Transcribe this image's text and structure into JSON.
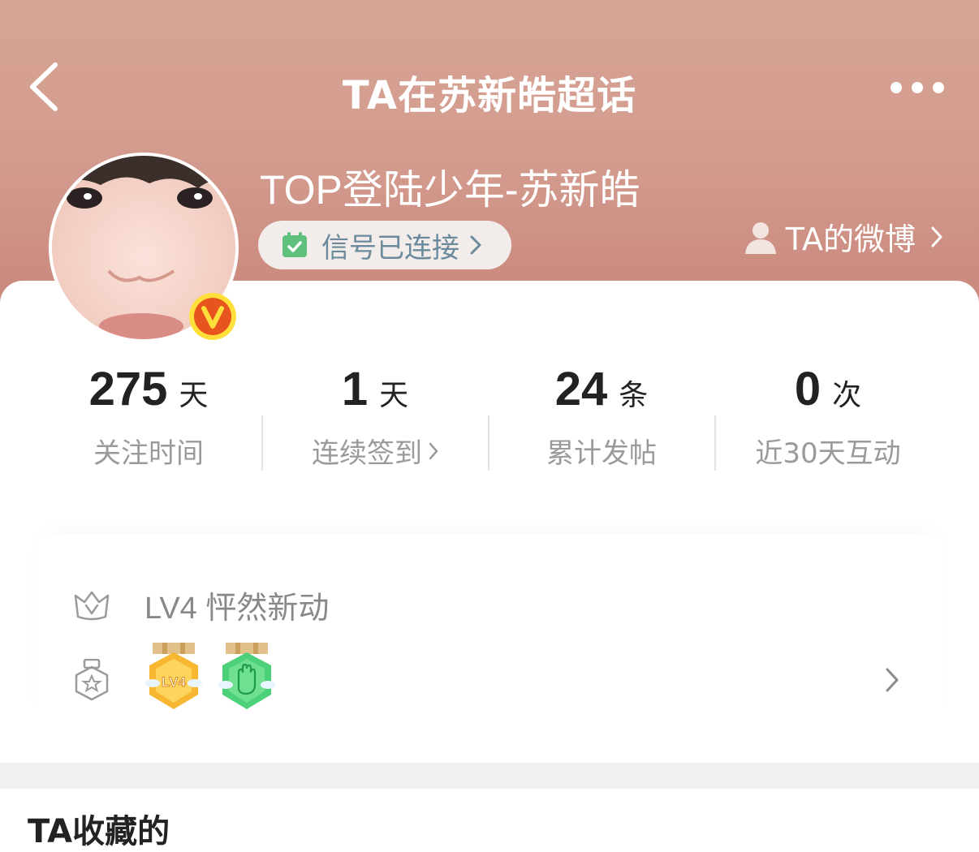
{
  "nav": {
    "title": "TA在苏新皓超话",
    "back_icon": "chevron-left-icon",
    "more_icon": "more-dots-icon"
  },
  "profile": {
    "name": "TOP登陆少年-苏新皓",
    "signal_label": "信号已连接",
    "weibo_link": "TA的微博",
    "verified_badge": "V"
  },
  "stats": [
    {
      "value": "275",
      "unit": "天",
      "label": "关注时间",
      "has_arrow": false
    },
    {
      "value": "1",
      "unit": "天",
      "label": "连续签到",
      "has_arrow": true
    },
    {
      "value": "24",
      "unit": "条",
      "label": "累计发帖",
      "has_arrow": false
    },
    {
      "value": "0",
      "unit": "次",
      "label": "近30天互动",
      "has_arrow": false
    }
  ],
  "level": {
    "text": "LV4 怦然新动"
  },
  "medals": [
    {
      "name": "lv4-medal",
      "text": "LV4",
      "color": "#f7b731"
    },
    {
      "name": "hand-medal",
      "color": "#4cd07a"
    }
  ],
  "section": {
    "title": "TA收藏的"
  },
  "colors": {
    "header_top": "#d7a596",
    "header_bottom": "#c88378",
    "accent_red": "#e8541e",
    "badge_yellow": "#ffd400"
  }
}
